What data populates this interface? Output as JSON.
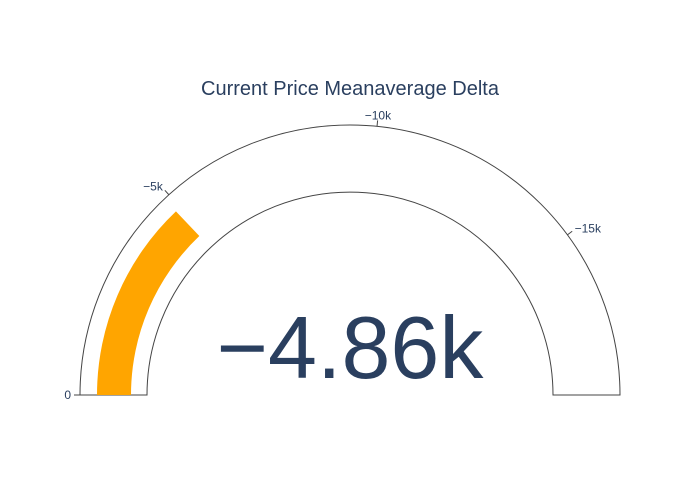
{
  "chart_data": {
    "type": "gauge",
    "title": "Current Price Meanaverage Delta",
    "value": -4860,
    "value_display": "−4.86k",
    "range": [
      0,
      -18800
    ],
    "ticks": [
      {
        "value": 0,
        "label": "0"
      },
      {
        "value": -5000,
        "label": "−5k"
      },
      {
        "value": -10000,
        "label": "−10k"
      },
      {
        "value": -15000,
        "label": "−15k"
      }
    ],
    "bar_color": "#ffa500",
    "text_color": "#2a3f5f",
    "border_color": "#444444"
  }
}
